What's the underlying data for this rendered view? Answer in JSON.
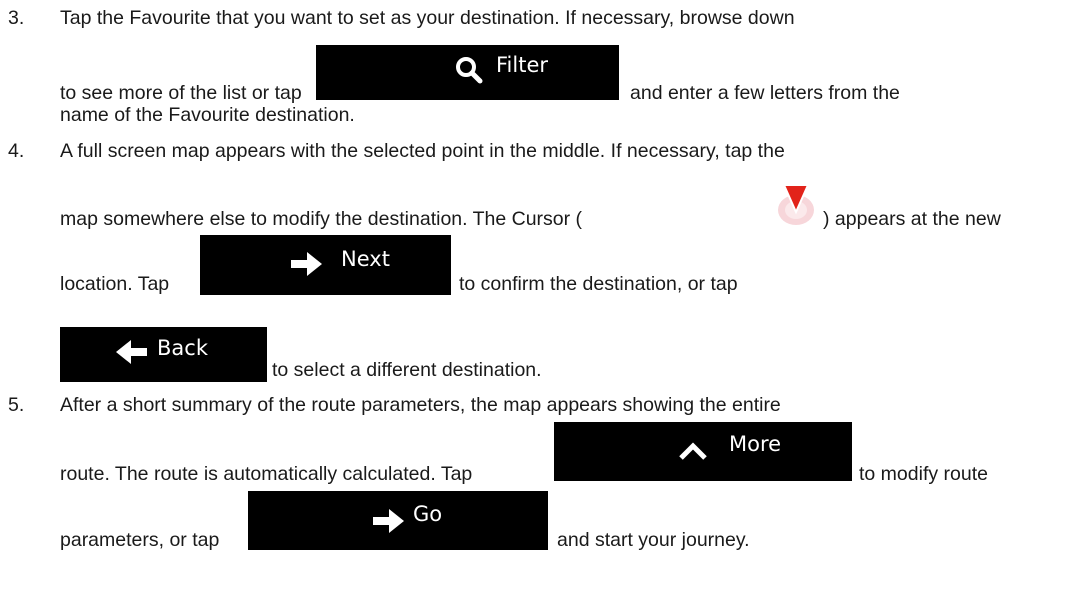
{
  "steps": [
    {
      "number": "3.",
      "line1": "Tap the Favourite that you want to set as your destination. If necessary, browse down",
      "line2a": "to see more of the list or tap",
      "button": {
        "label": "Filter",
        "icon": "search-icon"
      },
      "line2b": "and enter a few letters from the",
      "line3": "name of the Favourite destination."
    },
    {
      "number": "4.",
      "line1": "A full screen map appears with the selected point in the middle. If necessary, tap the",
      "line2a": "map somewhere else to modify the destination. The Cursor (",
      "cursor_icon": "map-cursor-icon",
      "line2b": ") appears at the new",
      "line3a": "location. Tap",
      "button_next": {
        "label": "Next",
        "icon": "arrow-right-icon"
      },
      "line3b": "to confirm the destination, or tap",
      "button_back": {
        "label": "Back",
        "icon": "arrow-left-icon"
      },
      "line4": "to select a different destination."
    },
    {
      "number": "5.",
      "line1": "After a short summary of the route parameters, the map appears showing the entire",
      "line2a": "route. The route is automatically calculated. Tap",
      "button_more": {
        "label": "More",
        "icon": "chevron-up-icon"
      },
      "line2b": "to modify route",
      "line3a": "parameters, or tap",
      "button_go": {
        "label": "Go",
        "icon": "arrow-right-icon"
      },
      "line3b": "and start your journey."
    }
  ]
}
